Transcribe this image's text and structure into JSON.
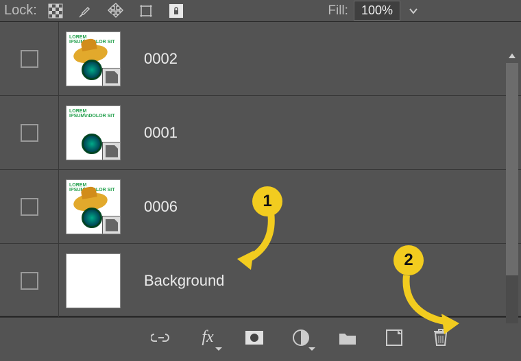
{
  "toolbar": {
    "lock_label": "Lock:",
    "fill_label": "Fill:",
    "fill_value": "100%"
  },
  "layers": [
    {
      "name": "0002",
      "kind": "hat"
    },
    {
      "name": "0001",
      "kind": "plain"
    },
    {
      "name": "0006",
      "kind": "hat"
    },
    {
      "name": "Background",
      "kind": "blank"
    }
  ],
  "annotations": {
    "marker1": "1",
    "marker2": "2"
  },
  "icons": {
    "lock": [
      "transparency",
      "brush",
      "move",
      "artboard",
      "lock-all"
    ],
    "bottom": [
      "link",
      "fx",
      "mask",
      "adjustment",
      "group",
      "new-layer",
      "trash"
    ]
  },
  "colors": {
    "annotation": "#f2cc1f"
  }
}
